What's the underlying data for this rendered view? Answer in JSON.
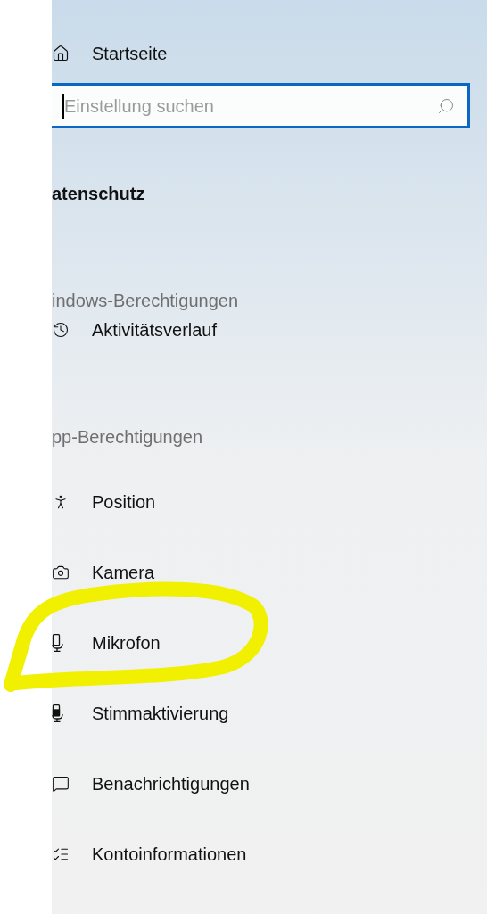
{
  "home": {
    "label": "Startseite"
  },
  "search": {
    "placeholder": "Einstellung suchen",
    "focused": true
  },
  "section_title": "atenschutz",
  "groups": [
    {
      "heading": "indows-Berechtigungen",
      "items": [
        {
          "label": "Aktivitätsverlauf",
          "kind": "history"
        }
      ]
    },
    {
      "heading": "pp-Berechtigungen",
      "items": [
        {
          "label": "Position",
          "kind": "position"
        },
        {
          "label": "Kamera",
          "kind": "camera"
        },
        {
          "label": "Mikrofon",
          "kind": "microphone"
        },
        {
          "label": "Stimmaktivierung",
          "kind": "voice"
        },
        {
          "label": "Benachrichtigungen",
          "kind": "notification"
        },
        {
          "label": "Kontoinformationen",
          "kind": "account"
        }
      ]
    }
  ]
}
